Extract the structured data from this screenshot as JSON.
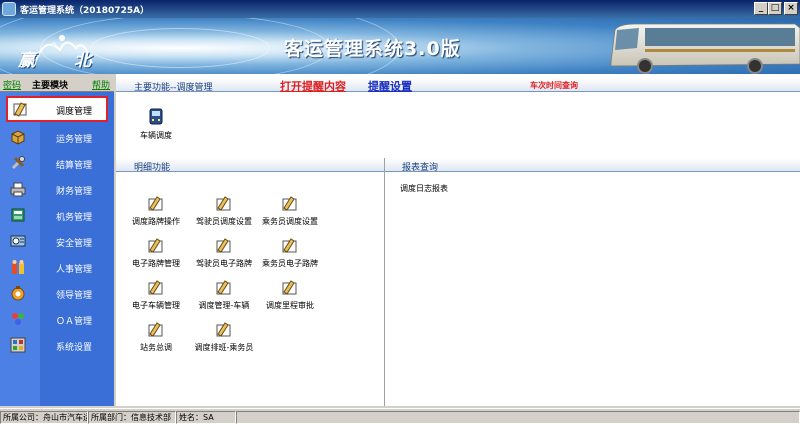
{
  "window": {
    "title": "客运管理系统（20180725A）",
    "min_label": "_",
    "max_label": "□",
    "close_label": "×"
  },
  "banner": {
    "logo_text": [
      "赢",
      "北"
    ],
    "title": "客运管理系统3.0版"
  },
  "left": {
    "secret_label": "密码",
    "title": "主要模块",
    "help_label": "帮助",
    "items": [
      {
        "label": "调度管理",
        "icon": "dispatch-icon",
        "selected": true
      },
      {
        "label": "运务管理",
        "icon": "box-icon"
      },
      {
        "label": "结算管理",
        "icon": "tools-icon"
      },
      {
        "label": "财务管理",
        "icon": "printer-icon"
      },
      {
        "label": "机务管理",
        "icon": "book-icon"
      },
      {
        "label": "安全管理",
        "icon": "safety-icon"
      },
      {
        "label": "人事管理",
        "icon": "people-icon"
      },
      {
        "label": "领导管理",
        "icon": "leader-icon"
      },
      {
        "label": "ＯＡ管理",
        "icon": "oa-icon"
      },
      {
        "label": "系统设置",
        "icon": "settings-icon"
      }
    ]
  },
  "main": {
    "main_func_label": "主要功能--调度管理",
    "open_reminder": "打开提醒内容",
    "reminder_settings": "提醒设置",
    "schedule_query": "车次时间查询",
    "vehicle_dispatch": "车辆调度",
    "detail_label": "明细功能",
    "report_label": "报表查询",
    "detail_items": [
      "调度路牌操作",
      "驾驶员调度设置",
      "乘务员调度设置",
      "电子路牌管理",
      "驾驶员电子路牌",
      "乘务员电子路牌",
      "电子车辆管理",
      "调度管理-车辆",
      "调度里程审批",
      "站务总调",
      "调度排班-乘务员"
    ],
    "report_items": [
      "调度日志报表"
    ]
  },
  "status": {
    "company": "所属公司：舟山市汽车运输",
    "department": "所属部门：信息技术部",
    "name": "姓名：SA",
    "empty": ""
  },
  "colors": {
    "title_bar": "#0a246a",
    "left_panel": "#3a6fd8",
    "highlight_border": "#e0202a",
    "link_red": "#e02020",
    "link_blue": "#1a30c0"
  }
}
